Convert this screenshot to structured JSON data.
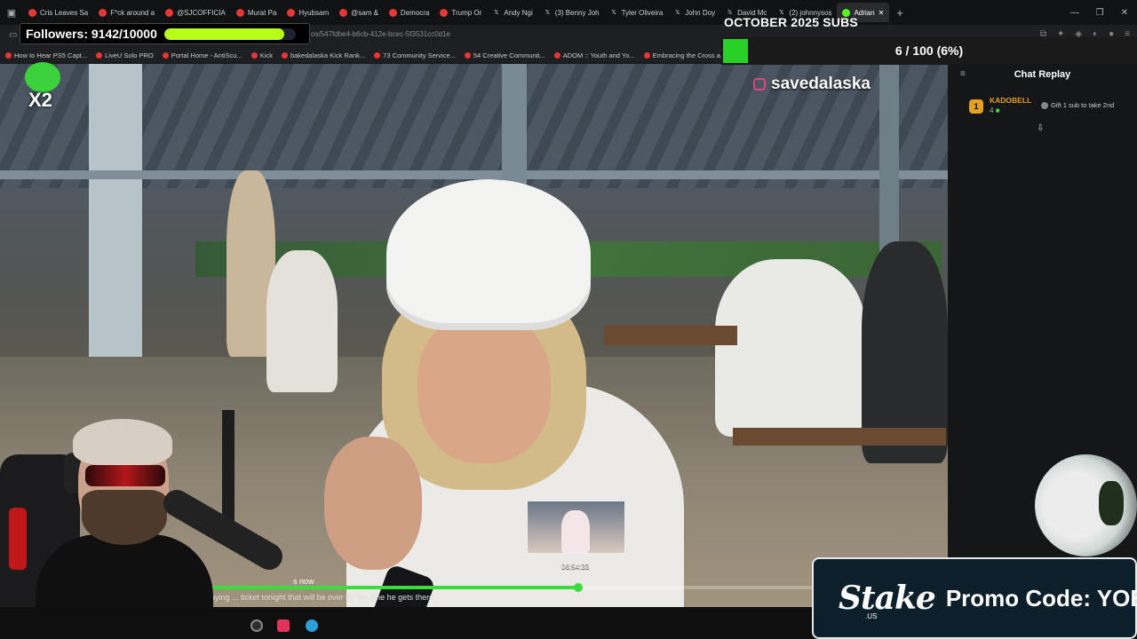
{
  "browser": {
    "tabs": [
      {
        "label": "Cris Leaves Sa",
        "icon": "youtube-icon",
        "color": "#e53935"
      },
      {
        "label": "F*ck around a",
        "icon": "youtube-icon",
        "color": "#e53935"
      },
      {
        "label": "@SJCOFFICIA",
        "icon": "youtube-icon",
        "color": "#e53935"
      },
      {
        "label": "Murat Pa",
        "icon": "youtube-icon",
        "color": "#e53935"
      },
      {
        "label": "Hyubsam",
        "icon": "youtube-icon",
        "color": "#e53935"
      },
      {
        "label": "@sam &",
        "icon": "youtube-icon",
        "color": "#e53935"
      },
      {
        "label": "Democra",
        "icon": "youtube-icon",
        "color": "#e53935"
      },
      {
        "label": "Trump Or",
        "icon": "youtube-icon",
        "color": "#e53935"
      },
      {
        "label": "Andy Ngi",
        "icon": "x-icon",
        "color": "#000000"
      },
      {
        "label": "(3) Benny Joh",
        "icon": "x-icon",
        "color": "#000000"
      },
      {
        "label": "Tyler Oliveira",
        "icon": "x-icon",
        "color": "#000000"
      },
      {
        "label": "John Doy",
        "icon": "x-icon",
        "color": "#000000"
      },
      {
        "label": "David Mc",
        "icon": "x-icon",
        "color": "#000000"
      },
      {
        "label": "(2) johnnysos",
        "icon": "x-icon",
        "color": "#000000"
      },
      {
        "label": "Adrian",
        "icon": "kick-icon",
        "color": "#53fc18",
        "active": true
      }
    ],
    "url": "os/547fdbe4-b6cb-412e-bcec-5f3531cc0d1e",
    "bookmarks": [
      "How to Hear PS5 Capt...",
      "LiveU Solo PRO",
      "Portal Home - AntiScu...",
      "Kick",
      "bakedalaska Kick Rank...",
      "73 Community Service...",
      "54 Creative Communit...",
      "ADOM :: Youth and Yo...",
      "Embracing the Cross a..."
    ]
  },
  "overlay": {
    "followers_label": "Followers: 9142/10000",
    "followers_progress": 0.9142,
    "subs_title": "OCTOBER 2025 SUBS",
    "subs_text": "6 / 100 (6%)",
    "subs_progress": 0.06,
    "multiplier": "X2",
    "instagram_handle": "savedalaska"
  },
  "player": {
    "thumb_time": "06:54:33",
    "caption_top": "s now",
    "caption": "paying ... ticket tonight that will be over by the time he gets there",
    "progress": 0.51,
    "accent": "#3ddc3d"
  },
  "chat": {
    "title": "Chat Replay",
    "gifter_rank": "1",
    "gifter_name": "KADOBELL",
    "gifter_count": "4",
    "gift_button": "Gift 1 sub to take 2nd"
  },
  "promo": {
    "brand": "Stake",
    "brand_suffix": ".US",
    "code": "Promo Code: YOBA"
  }
}
